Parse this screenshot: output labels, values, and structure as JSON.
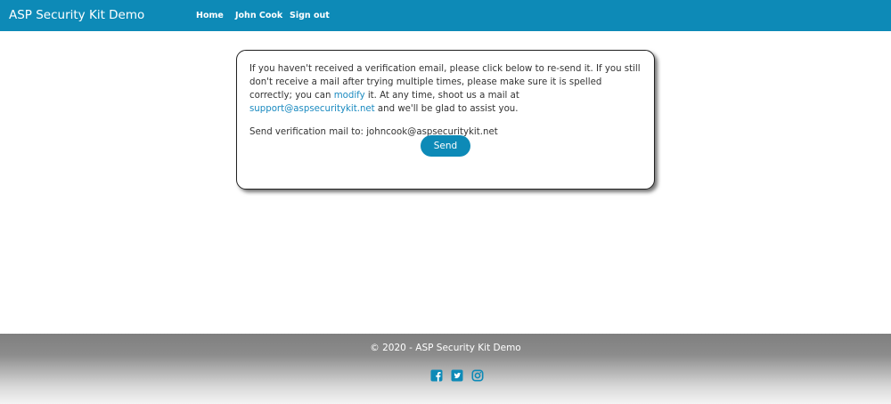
{
  "navbar": {
    "brand": "ASP Security Kit Demo",
    "links": [
      {
        "label": "Home"
      },
      {
        "label": "John Cook"
      },
      {
        "label": "Sign out"
      }
    ],
    "background_color": "#0d8ab7"
  },
  "card": {
    "message_part1": "If you haven't received a verification email, please click below to re-send it. If you still don't receive a mail after trying multiple times, please make sure it is spelled correctly; you can ",
    "modify_link": "modify",
    "message_part2": " it. At any time, shoot us a mail at ",
    "support_email": "support@aspsecuritykit.net",
    "message_part3": " and we'll be glad to assist you.",
    "send_to_label": "Send verification mail to: ",
    "send_to_email": "johncook@aspsecuritykit.net",
    "send_button": "Send",
    "link_color": "#1a8ac0"
  },
  "footer": {
    "copyright": "© 2020 - ASP Security Kit Demo",
    "social_icons": [
      "facebook-icon",
      "twitter-icon",
      "instagram-icon"
    ],
    "icon_color": "#0d8ab7"
  }
}
